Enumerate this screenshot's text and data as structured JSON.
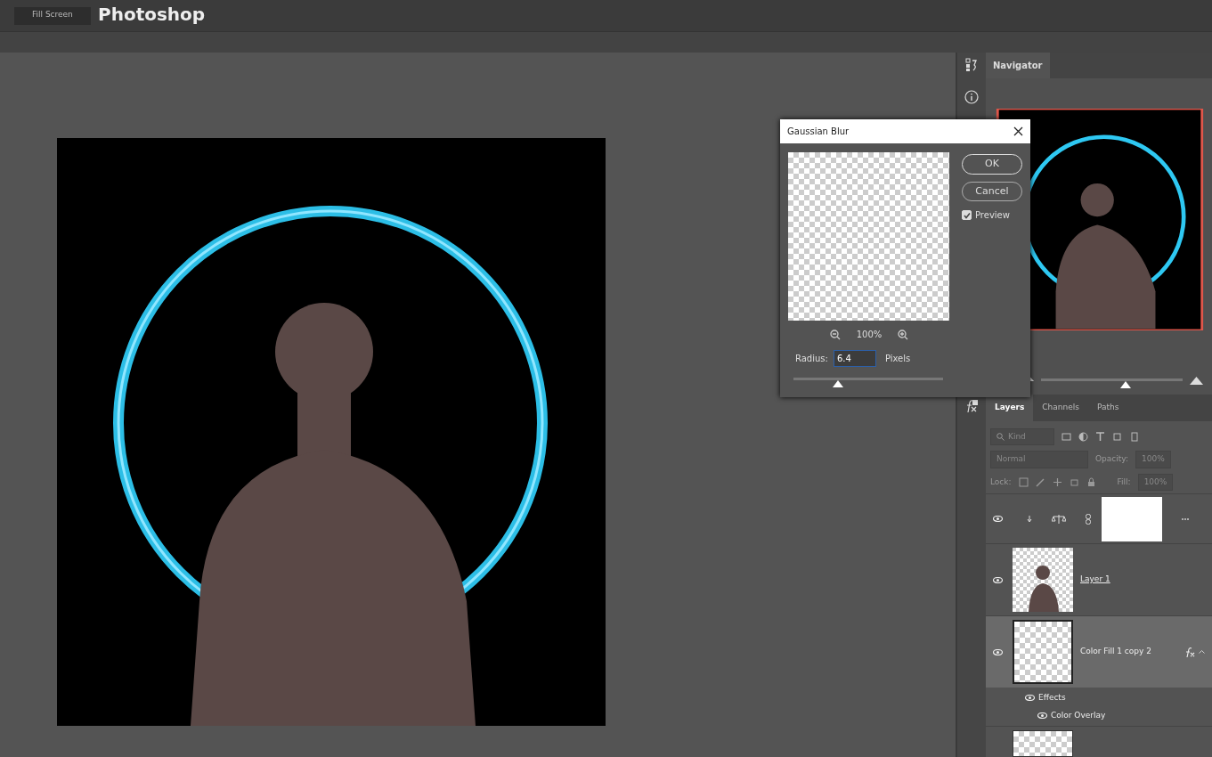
{
  "app_title": "Photoshop",
  "toolbar": {
    "button": "Fill Screen"
  },
  "dialog": {
    "title": "Gaussian Blur",
    "ok": "OK",
    "cancel": "Cancel",
    "preview": {
      "label": "Preview",
      "checked": true
    },
    "zoom": "100%",
    "radius_label": "Radius:",
    "radius_value": "6.4",
    "radius_unit": "Pixels",
    "slider": {
      "level": 0.3
    }
  },
  "navigator": {
    "tab": "Navigator",
    "zoom_slider": {
      "level": 0.6
    }
  },
  "layers_panel": {
    "tabs": [
      {
        "label": "Layers",
        "selected": true
      },
      {
        "label": "Channels",
        "selected": false
      },
      {
        "label": "Paths",
        "selected": false
      }
    ],
    "filter": {
      "placeholder": "Kind"
    },
    "blend_mode": "Normal",
    "opacity_label": "Opacity:",
    "opacity": "100%",
    "lock_label": "Lock:",
    "fill_label": "Fill:",
    "fill": "100%",
    "layers": [
      {
        "kind": "adjustment",
        "visible": true,
        "selected": false
      },
      {
        "kind": "pixel",
        "name": "Layer 1",
        "visible": true,
        "selected": false
      },
      {
        "kind": "fill",
        "name": "Color Fill 1 copy 2",
        "visible": true,
        "selected": true,
        "effects_label": "Effects",
        "effects": [
          "Color Overlay"
        ]
      },
      {
        "kind": "partial",
        "visible": false,
        "selected": false
      }
    ]
  }
}
